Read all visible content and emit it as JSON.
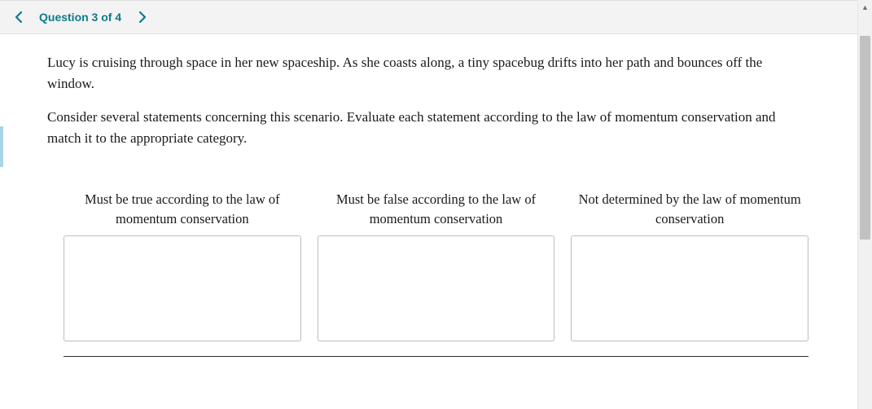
{
  "header": {
    "question_indicator": "Question 3 of 4"
  },
  "prompt": {
    "p1": "Lucy is cruising through space in her new spaceship. As she coasts along, a tiny spacebug drifts into her path and bounces off the window.",
    "p2": "Consider several statements concerning this scenario. Evaluate each statement according to the law of momentum conservation and match it to the appropriate category."
  },
  "categories": [
    {
      "label": "Must be true according to the law of momentum conservation"
    },
    {
      "label": "Must be false according to the law of momentum conservation"
    },
    {
      "label": "Not determined by the law of momentum conservation"
    }
  ]
}
